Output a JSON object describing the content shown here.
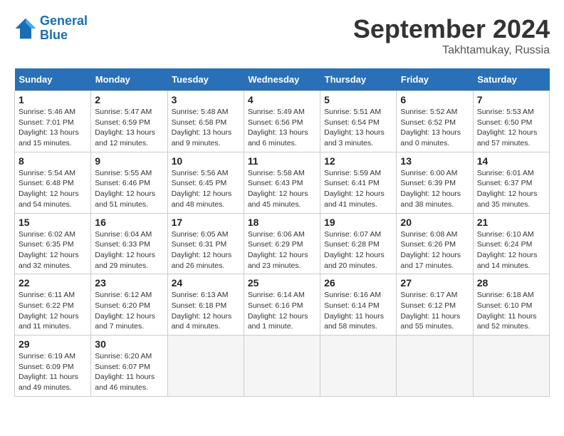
{
  "header": {
    "logo_line1": "General",
    "logo_line2": "Blue",
    "month_title": "September 2024",
    "location": "Takhtamukay, Russia"
  },
  "weekdays": [
    "Sunday",
    "Monday",
    "Tuesday",
    "Wednesday",
    "Thursday",
    "Friday",
    "Saturday"
  ],
  "days": [
    {
      "date": 1,
      "sunrise": "5:46 AM",
      "sunset": "7:01 PM",
      "daylight": "13 hours and 15 minutes."
    },
    {
      "date": 2,
      "sunrise": "5:47 AM",
      "sunset": "6:59 PM",
      "daylight": "13 hours and 12 minutes."
    },
    {
      "date": 3,
      "sunrise": "5:48 AM",
      "sunset": "6:58 PM",
      "daylight": "13 hours and 9 minutes."
    },
    {
      "date": 4,
      "sunrise": "5:49 AM",
      "sunset": "6:56 PM",
      "daylight": "13 hours and 6 minutes."
    },
    {
      "date": 5,
      "sunrise": "5:51 AM",
      "sunset": "6:54 PM",
      "daylight": "13 hours and 3 minutes."
    },
    {
      "date": 6,
      "sunrise": "5:52 AM",
      "sunset": "6:52 PM",
      "daylight": "13 hours and 0 minutes."
    },
    {
      "date": 7,
      "sunrise": "5:53 AM",
      "sunset": "6:50 PM",
      "daylight": "12 hours and 57 minutes."
    },
    {
      "date": 8,
      "sunrise": "5:54 AM",
      "sunset": "6:48 PM",
      "daylight": "12 hours and 54 minutes."
    },
    {
      "date": 9,
      "sunrise": "5:55 AM",
      "sunset": "6:46 PM",
      "daylight": "12 hours and 51 minutes."
    },
    {
      "date": 10,
      "sunrise": "5:56 AM",
      "sunset": "6:45 PM",
      "daylight": "12 hours and 48 minutes."
    },
    {
      "date": 11,
      "sunrise": "5:58 AM",
      "sunset": "6:43 PM",
      "daylight": "12 hours and 45 minutes."
    },
    {
      "date": 12,
      "sunrise": "5:59 AM",
      "sunset": "6:41 PM",
      "daylight": "12 hours and 41 minutes."
    },
    {
      "date": 13,
      "sunrise": "6:00 AM",
      "sunset": "6:39 PM",
      "daylight": "12 hours and 38 minutes."
    },
    {
      "date": 14,
      "sunrise": "6:01 AM",
      "sunset": "6:37 PM",
      "daylight": "12 hours and 35 minutes."
    },
    {
      "date": 15,
      "sunrise": "6:02 AM",
      "sunset": "6:35 PM",
      "daylight": "12 hours and 32 minutes."
    },
    {
      "date": 16,
      "sunrise": "6:04 AM",
      "sunset": "6:33 PM",
      "daylight": "12 hours and 29 minutes."
    },
    {
      "date": 17,
      "sunrise": "6:05 AM",
      "sunset": "6:31 PM",
      "daylight": "12 hours and 26 minutes."
    },
    {
      "date": 18,
      "sunrise": "6:06 AM",
      "sunset": "6:29 PM",
      "daylight": "12 hours and 23 minutes."
    },
    {
      "date": 19,
      "sunrise": "6:07 AM",
      "sunset": "6:28 PM",
      "daylight": "12 hours and 20 minutes."
    },
    {
      "date": 20,
      "sunrise": "6:08 AM",
      "sunset": "6:26 PM",
      "daylight": "12 hours and 17 minutes."
    },
    {
      "date": 21,
      "sunrise": "6:10 AM",
      "sunset": "6:24 PM",
      "daylight": "12 hours and 14 minutes."
    },
    {
      "date": 22,
      "sunrise": "6:11 AM",
      "sunset": "6:22 PM",
      "daylight": "12 hours and 11 minutes."
    },
    {
      "date": 23,
      "sunrise": "6:12 AM",
      "sunset": "6:20 PM",
      "daylight": "12 hours and 7 minutes."
    },
    {
      "date": 24,
      "sunrise": "6:13 AM",
      "sunset": "6:18 PM",
      "daylight": "12 hours and 4 minutes."
    },
    {
      "date": 25,
      "sunrise": "6:14 AM",
      "sunset": "6:16 PM",
      "daylight": "12 hours and 1 minute."
    },
    {
      "date": 26,
      "sunrise": "6:16 AM",
      "sunset": "6:14 PM",
      "daylight": "11 hours and 58 minutes."
    },
    {
      "date": 27,
      "sunrise": "6:17 AM",
      "sunset": "6:12 PM",
      "daylight": "11 hours and 55 minutes."
    },
    {
      "date": 28,
      "sunrise": "6:18 AM",
      "sunset": "6:10 PM",
      "daylight": "11 hours and 52 minutes."
    },
    {
      "date": 29,
      "sunrise": "6:19 AM",
      "sunset": "6:09 PM",
      "daylight": "11 hours and 49 minutes."
    },
    {
      "date": 30,
      "sunrise": "6:20 AM",
      "sunset": "6:07 PM",
      "daylight": "11 hours and 46 minutes."
    }
  ],
  "start_weekday": 0
}
